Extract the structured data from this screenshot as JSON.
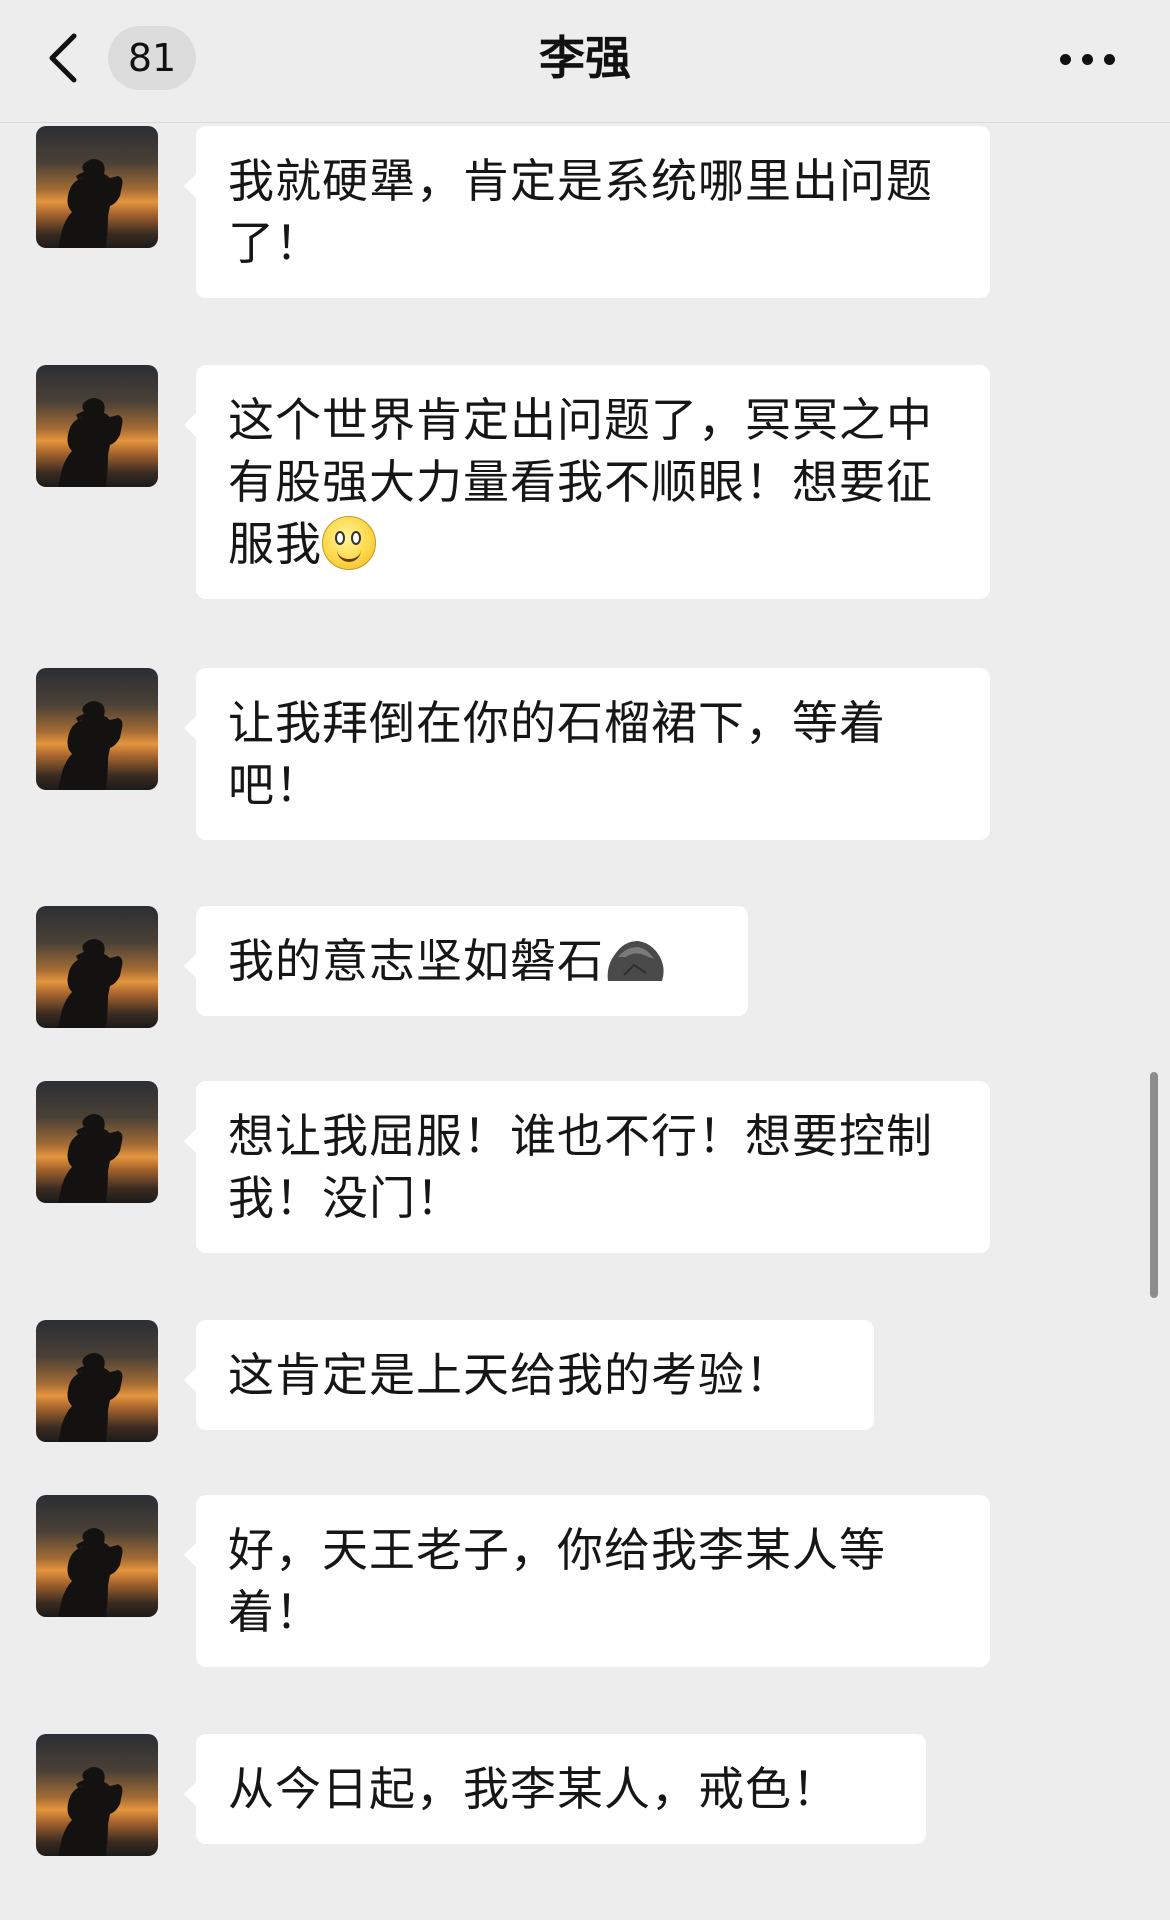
{
  "header": {
    "back_badge": "81",
    "title": "李强"
  },
  "icons": {
    "back": "chevron-left-icon",
    "more": "more-dots-icon",
    "smile": "smile-emoji-icon",
    "rock": "rock-emoji-icon"
  },
  "messages": [
    {
      "text": "我就硬犟，肯定是系统哪里出问题了！"
    },
    {
      "text": "这个世界肯定出问题了，冥冥之中有股强大力量看我不顺眼！想要征服我"
    },
    {
      "text": "让我拜倒在你的石榴裙下，等着吧！"
    },
    {
      "text": "我的意志坚如磐石"
    },
    {
      "text": "想让我屈服！谁也不行！想要控制我！没门！"
    },
    {
      "text": "这肯定是上天给我的考验！"
    },
    {
      "text": "好，天王老子，你给我李某人等着！"
    },
    {
      "text": "从今日起，我李某人，戒色！"
    }
  ],
  "colors": {
    "background": "#ededed",
    "bubble": "#ffffff",
    "text": "#161616"
  }
}
